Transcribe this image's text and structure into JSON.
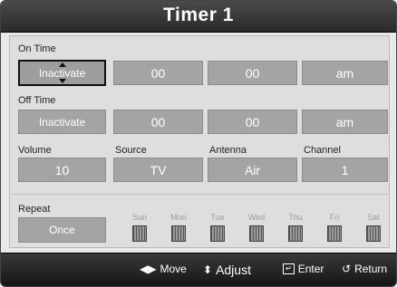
{
  "title": "Timer 1",
  "on_time": {
    "label": "On Time",
    "activation": "Inactivate",
    "hour": "00",
    "minute": "00",
    "ampm": "am"
  },
  "off_time": {
    "label": "Off Time",
    "activation": "Inactivate",
    "hour": "00",
    "minute": "00",
    "ampm": "am"
  },
  "settings": {
    "volume_label": "Volume",
    "volume_value": "10",
    "source_label": "Source",
    "source_value": "TV",
    "antenna_label": "Antenna",
    "antenna_value": "Air",
    "channel_label": "Channel",
    "channel_value": "1"
  },
  "repeat": {
    "label": "Repeat",
    "value": "Once",
    "days": [
      "Sun",
      "Mon",
      "Tue",
      "Wed",
      "Thu",
      "Fri",
      "Sat"
    ]
  },
  "footer": {
    "move": "Move",
    "adjust": "Adjust",
    "enter": "Enter",
    "return": "Return"
  }
}
